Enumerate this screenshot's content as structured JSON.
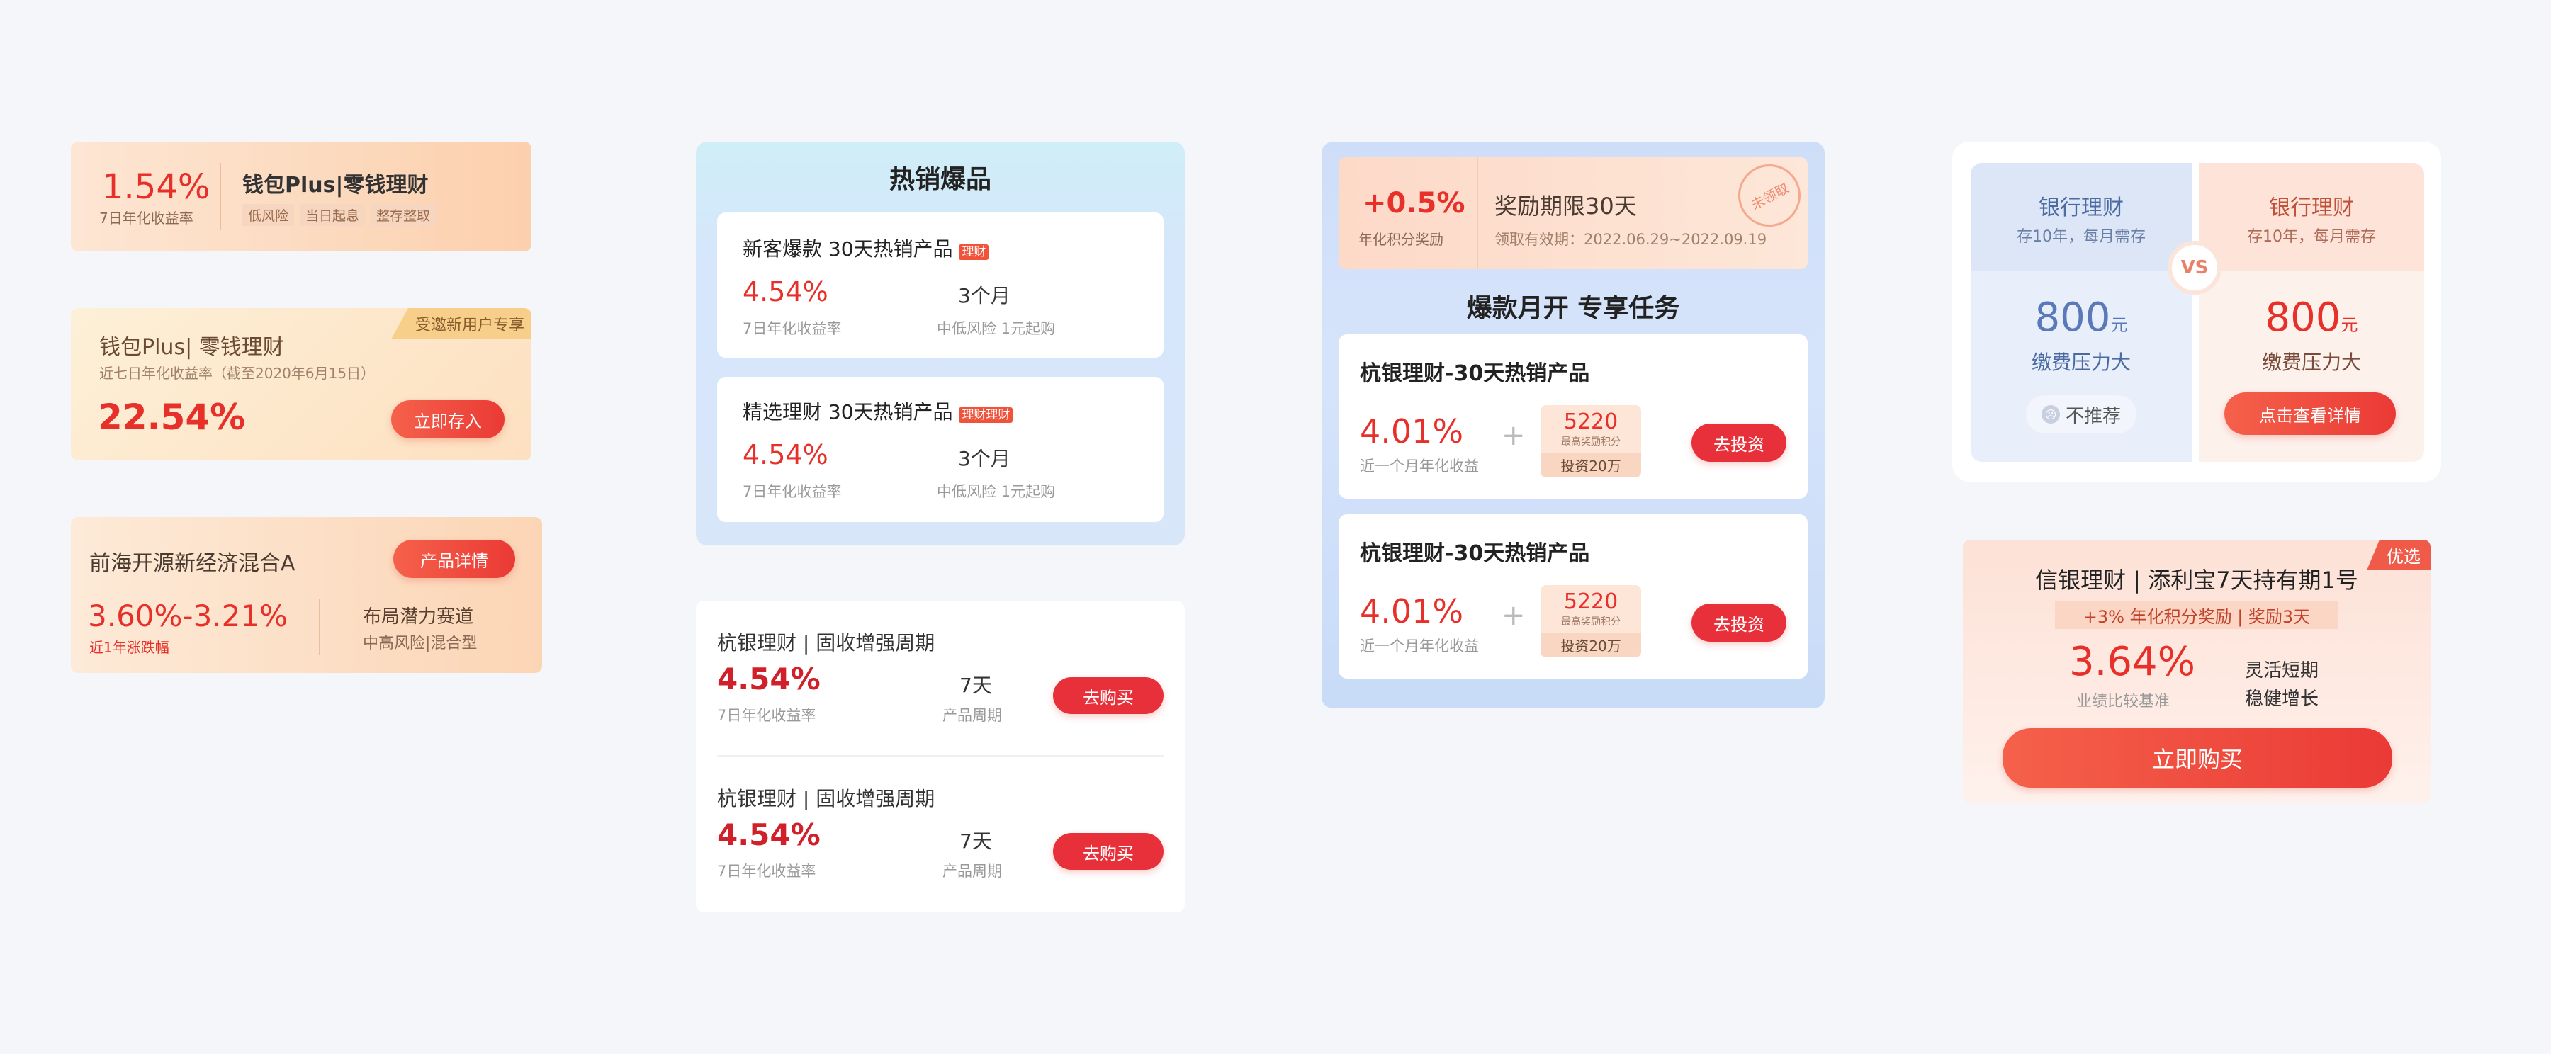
{
  "c1": {
    "rate": "1.54%",
    "rate_label": "7日年化收益率",
    "title": "钱包Plus|零钱理财",
    "tags": [
      "低风险",
      "当日起息",
      "整存整取"
    ]
  },
  "c2": {
    "badge": "受邀新用户专享",
    "title": "钱包Plus| 零钱理财",
    "sub": "近七日年化收益率（截至2020年6月15日）",
    "rate": "22.54%",
    "btn": "立即存入"
  },
  "c3": {
    "title": "前海开源新经济混合A",
    "btn": "产品详情",
    "rate": "3.60%-3.21%",
    "rate_label": "近1年涨跌幅",
    "r1": "布局潜力赛道",
    "r2": "中高风险|混合型"
  },
  "hot": {
    "title": "热销爆品",
    "items": [
      {
        "name": "新客爆款  30天热销产品",
        "tag": "理财",
        "rate": "4.54%",
        "rate_label": "7日年化收益率",
        "term": "3个月",
        "term_label": "中低风险 1元起购"
      },
      {
        "name": "精选理财 30天热销产品",
        "tag": "理财理财",
        "rate": "4.54%",
        "rate_label": "7日年化收益率",
        "term": "3个月",
        "term_label": "中低风险 1元起购"
      }
    ]
  },
  "list": {
    "items": [
      {
        "name": "杭银理财 | 固收增强周期",
        "rate": "4.54%",
        "rate_label": "7日年化收益率",
        "term": "7天",
        "term_label": "产品周期",
        "btn": "去购买"
      },
      {
        "name": "杭银理财 | 固收增强周期",
        "rate": "4.54%",
        "rate_label": "7日年化收益率",
        "term": "7天",
        "term_label": "产品周期",
        "btn": "去购买"
      }
    ]
  },
  "task": {
    "bonus": "+0.5%",
    "bonus_label": "年化积分奖励",
    "period": "奖励期限30天",
    "valid": "领取有效期：2022.06.29~2022.09.19",
    "stamp": "未领取",
    "title": "爆款月开 专享任务",
    "items": [
      {
        "name": "杭银理财-30天热销产品",
        "rate": "4.01%",
        "rate_label": "近一个月年化收益",
        "points": "5220",
        "points_label": "最高奖励积分",
        "invest": "投资20万",
        "btn": "去投资"
      },
      {
        "name": "杭银理财-30天热销产品",
        "rate": "4.01%",
        "rate_label": "近一个月年化收益",
        "points": "5220",
        "points_label": "最高奖励积分",
        "invest": "投资20万",
        "btn": "去投资"
      }
    ]
  },
  "vs": {
    "vs": "VS",
    "left": {
      "title": "银行理财",
      "sub": "存10年，每月需存",
      "amount": "800",
      "unit": "元",
      "desc": "缴费压力大",
      "btn": "不推荐"
    },
    "right": {
      "title": "银行理财",
      "sub": "存10年，每月需存",
      "amount": "800",
      "unit": "元",
      "desc": "缴费压力大",
      "btn": "点击查看详情"
    }
  },
  "prem": {
    "badge": "优选",
    "title": "信银理财 | 添利宝7天持有期1号",
    "bonus": "+3% 年化积分奖励 | 奖励3天",
    "rate": "3.64%",
    "rate_label": "业绩比较基准",
    "f1": "灵活短期",
    "f2": "稳健增长",
    "btn": "立即购买"
  }
}
